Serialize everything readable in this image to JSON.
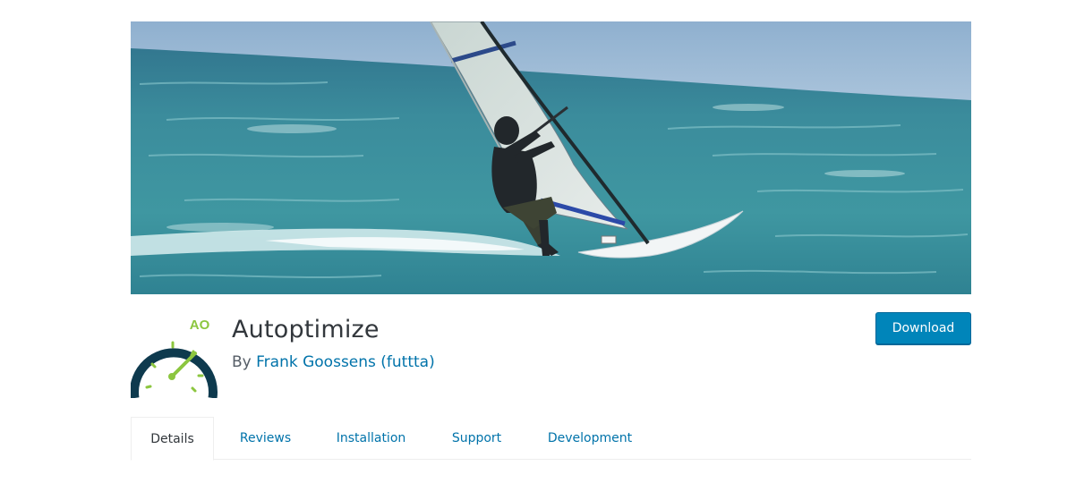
{
  "banner": {
    "alt": "Windsurfer on turquoise sea"
  },
  "plugin": {
    "name": "Autoptimize",
    "author_prefix": "By",
    "author_name": "Frank Goossens (futtta)",
    "icon_badge": "AO",
    "icon_colors": {
      "ring": "#0e3a4e",
      "accent": "#8cc63f"
    }
  },
  "actions": {
    "download_label": "Download",
    "download_color": "#0085ba"
  },
  "tabs": [
    {
      "label": "Details",
      "active": true
    },
    {
      "label": "Reviews",
      "active": false
    },
    {
      "label": "Installation",
      "active": false
    },
    {
      "label": "Support",
      "active": false
    },
    {
      "label": "Development",
      "active": false
    }
  ]
}
